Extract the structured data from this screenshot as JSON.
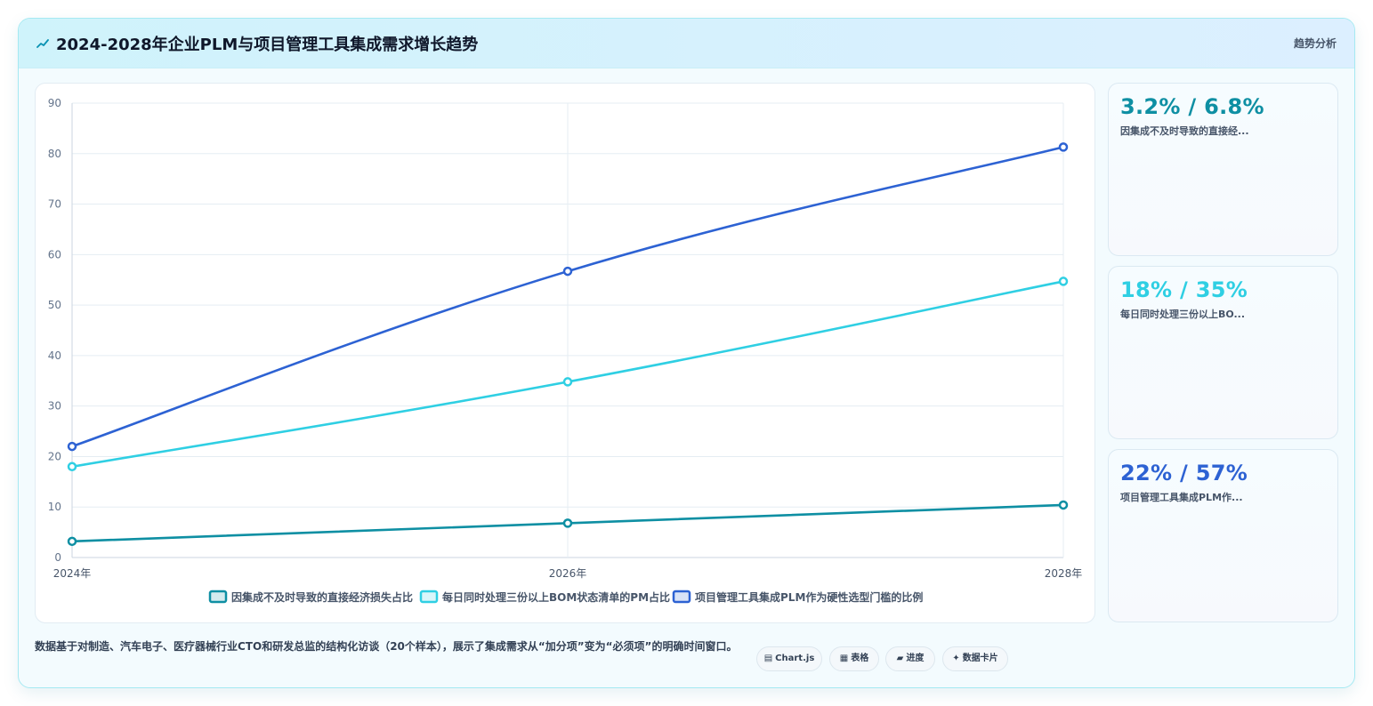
{
  "header": {
    "title": "2024-2028年企业PLM与项目管理工具集成需求增长趋势",
    "tag": "趋势分析",
    "icon": "trend-icon"
  },
  "chart_data": {
    "type": "line",
    "x": [
      "2024年",
      "2026年",
      "2028年"
    ],
    "ylim": [
      0,
      90
    ],
    "yticks": [
      0,
      10,
      20,
      30,
      40,
      50,
      60,
      70,
      80,
      90
    ],
    "grid": true,
    "legend_position": "bottom",
    "series": [
      {
        "name": "因集成不及时导致的直接经济损失占比",
        "values": [
          3.2,
          6.8,
          10.4
        ],
        "color": "#0e8fa3"
      },
      {
        "name": "每日同时处理三份以上BOM状态清单的PM占比",
        "values": [
          18,
          34.8,
          54.7
        ],
        "color": "#2fcfe3"
      },
      {
        "name": "项目管理工具集成PLM作为硬性选型门槛的比例",
        "values": [
          22,
          56.7,
          81.3
        ],
        "color": "#2d62d3"
      }
    ]
  },
  "stats": [
    {
      "value": "3.2% / 6.8%",
      "label": "因集成不及时导致的直接经...",
      "color": "#0e8fa3"
    },
    {
      "value": "18% / 35%",
      "label": "每日同时处理三份以上BO...",
      "color": "#2fcfe3"
    },
    {
      "value": "22% / 57%",
      "label": "项目管理工具集成PLM作...",
      "color": "#2d62d3"
    }
  ],
  "footnote": "数据基于对制造、汽车电子、医疗器械行业CTO和研发总监的结构化访谈（20个样本），展示了集成需求从“加分项”变为“必须项”的明确时间窗口。",
  "chips": [
    {
      "icon": "▤",
      "label": "Chart.js"
    },
    {
      "icon": "▦",
      "label": "表格"
    },
    {
      "icon": "▰",
      "label": "进度"
    },
    {
      "icon": "✦",
      "label": "数据卡片"
    }
  ]
}
